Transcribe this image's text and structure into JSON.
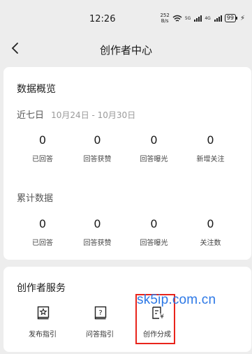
{
  "status_bar": {
    "time": "12:26",
    "net_speed_value": "252",
    "net_speed_unit": "B/s",
    "sig1_label": "5G",
    "sig2_label": "4G",
    "battery": "99",
    "icons": [
      "wifi-icon",
      "signal-icon",
      "battery-icon",
      "charging-icon"
    ]
  },
  "nav": {
    "title": "创作者中心",
    "back_icon": "chevron-left-icon"
  },
  "overview": {
    "title": "数据概览",
    "recent_label": "近七日",
    "recent_range": "10月24日 - 10月30日",
    "recent_stats": [
      {
        "value": "0",
        "label": "已回答"
      },
      {
        "value": "0",
        "label": "回答获赞"
      },
      {
        "value": "0",
        "label": "回答曝光"
      },
      {
        "value": "0",
        "label": "新增关注"
      }
    ],
    "total_label": "累计数据",
    "total_stats": [
      {
        "value": "0",
        "label": "已回答"
      },
      {
        "value": "0",
        "label": "回答获赞"
      },
      {
        "value": "0",
        "label": "回答曝光"
      },
      {
        "value": "0",
        "label": "关注数"
      }
    ]
  },
  "services": {
    "title": "创作者服务",
    "items": [
      {
        "label": "发布指引",
        "icon": "publish-guide-icon"
      },
      {
        "label": "问答指引",
        "icon": "qa-guide-icon"
      },
      {
        "label": "创作分成",
        "icon": "revenue-share-icon"
      }
    ]
  },
  "watermark": "sk5ip.com.cn",
  "colors": {
    "background": "#ededed",
    "card": "#ffffff",
    "highlight_box": "#e8241b",
    "watermark": "#2c78e6"
  }
}
